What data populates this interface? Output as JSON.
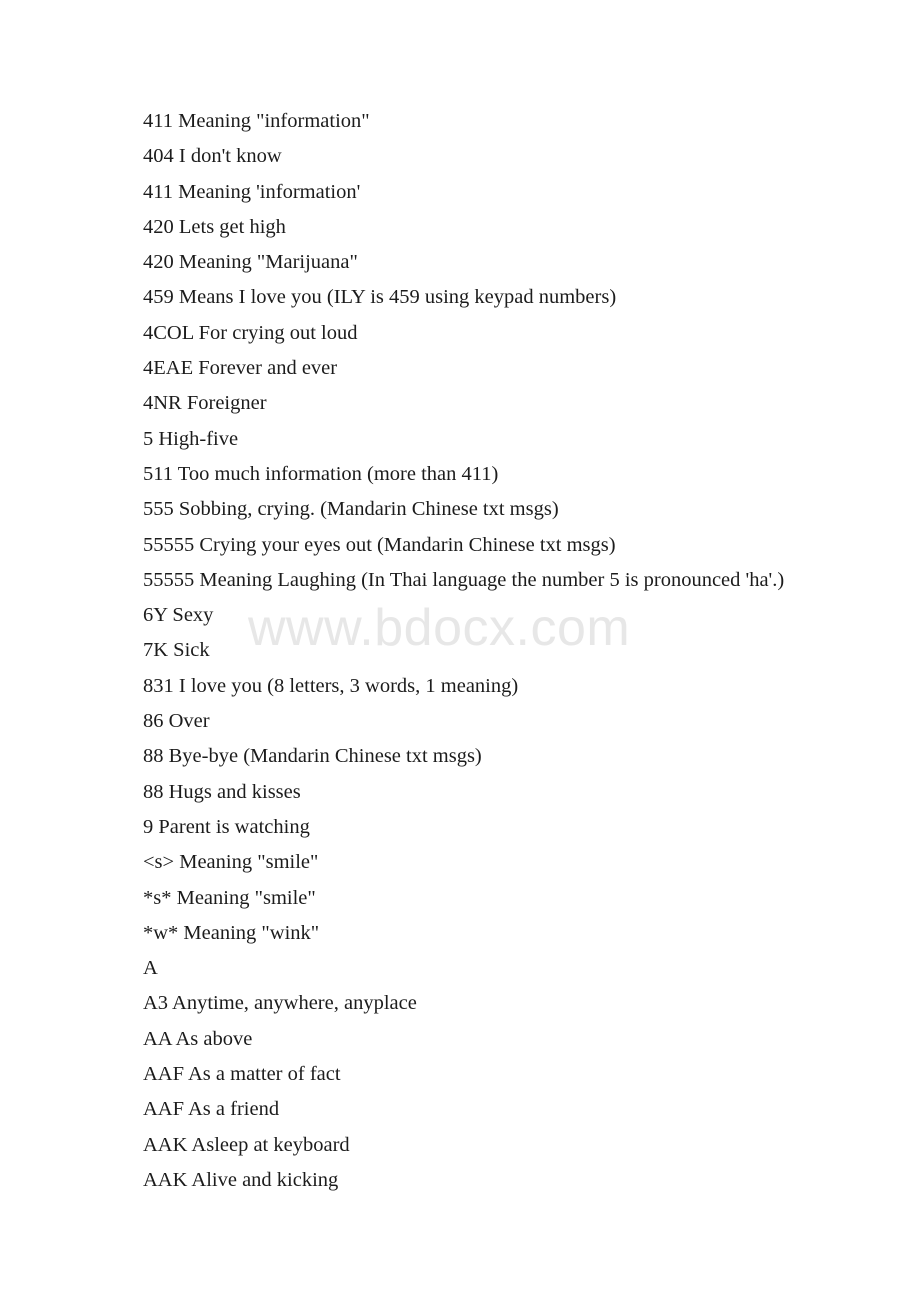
{
  "document": {
    "background_color": "#ffffff",
    "text_color": "#1c1c1c",
    "watermark": {
      "text": "www.bdocx.com",
      "color": "#e7e7e7"
    },
    "lines": [
      "411 Meaning \"information\"",
      "404 I don't know",
      "411 Meaning 'information'",
      "420 Lets get high",
      "420 Meaning \"Marijuana\"",
      "459 Means I love you (ILY is 459 using keypad numbers)",
      "4COL For crying out loud",
      "4EAE Forever and ever",
      "4NR Foreigner",
      "5 High-five",
      "511 Too much information (more than 411)",
      "555 Sobbing, crying. (Mandarin Chinese txt msgs)",
      "55555 Crying your eyes out (Mandarin Chinese txt msgs)",
      "55555 Meaning Laughing (In Thai language the number 5 is pronounced 'ha'.)",
      "6Y Sexy",
      "7K Sick",
      "831 I love you (8 letters, 3 words, 1 meaning)",
      "86 Over",
      "88 Bye-bye (Mandarin Chinese txt msgs)",
      "88 Hugs and kisses",
      "9 Parent is watching",
      "<s> Meaning \"smile\"",
      "*s* Meaning \"smile\"",
      "*w* Meaning \"wink\"",
      "A",
      "A3 Anytime, anywhere, anyplace",
      "AA As above",
      "AAF As a matter of fact",
      "AAF As a friend",
      "AAK Asleep at keyboard",
      "AAK Alive and kicking"
    ]
  }
}
